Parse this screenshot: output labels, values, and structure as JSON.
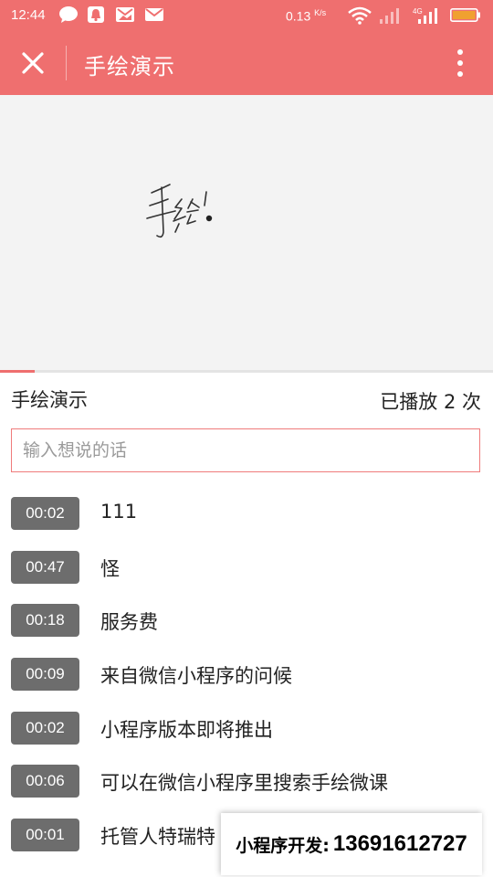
{
  "status_bar": {
    "time": "12:44",
    "speed": "0.13",
    "speed_unit": "K/s",
    "network_label": "4G",
    "notification_icons": [
      "chat-bubble-icon",
      "bell-icon",
      "image-mail-icon",
      "mail-icon"
    ],
    "battery_color": "#f0a030"
  },
  "app_bar": {
    "title": "手绘演示",
    "close_icon": "close-icon",
    "more_icon": "more-vertical-icon",
    "color": "#ef6f6f"
  },
  "canvas": {
    "handwriting_text": "手绘",
    "playback_progress": 0.07
  },
  "info": {
    "title": "手绘演示",
    "play_count": "已播放 2 次"
  },
  "comment_input": {
    "value": "",
    "placeholder": "输入想说的话"
  },
  "comments": [
    {
      "time": "00:02",
      "text": "111"
    },
    {
      "time": "00:47",
      "text": "怪"
    },
    {
      "time": "00:18",
      "text": "服务费"
    },
    {
      "time": "00:09",
      "text": "来自微信小程序的问候"
    },
    {
      "time": "00:02",
      "text": "小程序版本即将推出"
    },
    {
      "time": "00:06",
      "text": "可以在微信小程序里搜索手绘微课"
    },
    {
      "time": "00:01",
      "text": "托管人特瑞特"
    }
  ],
  "promo": {
    "label": "小程序开发:",
    "phone": "13691612727"
  }
}
